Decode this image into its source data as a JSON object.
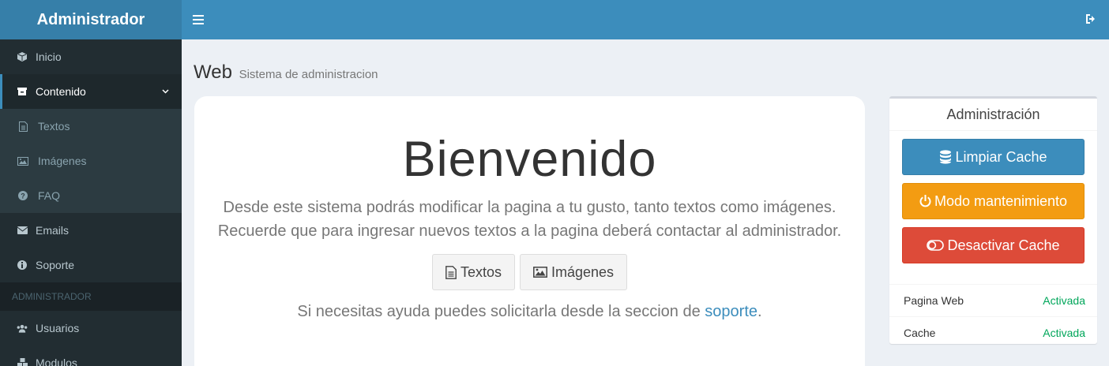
{
  "header": {
    "brand": "Administrador"
  },
  "sidebar": {
    "items": [
      {
        "label": "Inicio",
        "icon": "cube-icon"
      },
      {
        "label": "Contenido",
        "icon": "archive-icon"
      }
    ],
    "submenu": [
      {
        "label": "Textos",
        "icon": "file-text-icon"
      },
      {
        "label": "Imágenes",
        "icon": "image-icon"
      },
      {
        "label": "FAQ",
        "icon": "question-circle-icon"
      }
    ],
    "items2": [
      {
        "label": "Emails",
        "icon": "envelope-icon"
      },
      {
        "label": "Soporte",
        "icon": "info-circle-icon"
      }
    ],
    "section_header": "ADMINISTRADOR",
    "admin_items": [
      {
        "label": "Usuarios",
        "icon": "users-icon"
      },
      {
        "label": "Modulos",
        "icon": "cubes-icon"
      }
    ]
  },
  "page": {
    "title": "Web",
    "subtitle": "Sistema de administracion"
  },
  "welcome": {
    "heading": "Bienvenido",
    "lead": "Desde este sistema podrás modificar la pagina a tu gusto, tanto textos como imágenes. Recuerde que para ingresar nuevos textos a la pagina deberá contactar al administrador.",
    "btn_textos": "Textos",
    "btn_imagenes": "Imágenes",
    "help_prefix": "Si necesitas ayuda puedes solicitarla desde la seccion de ",
    "help_link": "soporte",
    "help_suffix": "."
  },
  "admin_box": {
    "title": "Administración",
    "btn_clear": "Limpiar Cache",
    "btn_maintenance": "Modo mantenimiento",
    "btn_disable": "Desactivar Cache",
    "status": [
      {
        "label": "Pagina Web",
        "value": "Activada"
      },
      {
        "label": "Cache",
        "value": "Activada"
      }
    ]
  },
  "colors": {
    "header": "#3c8dbc",
    "brand": "#367fa9",
    "sidebar": "#222d32",
    "success": "#00a65a",
    "warning": "#f39c12",
    "danger": "#dd4b39"
  }
}
